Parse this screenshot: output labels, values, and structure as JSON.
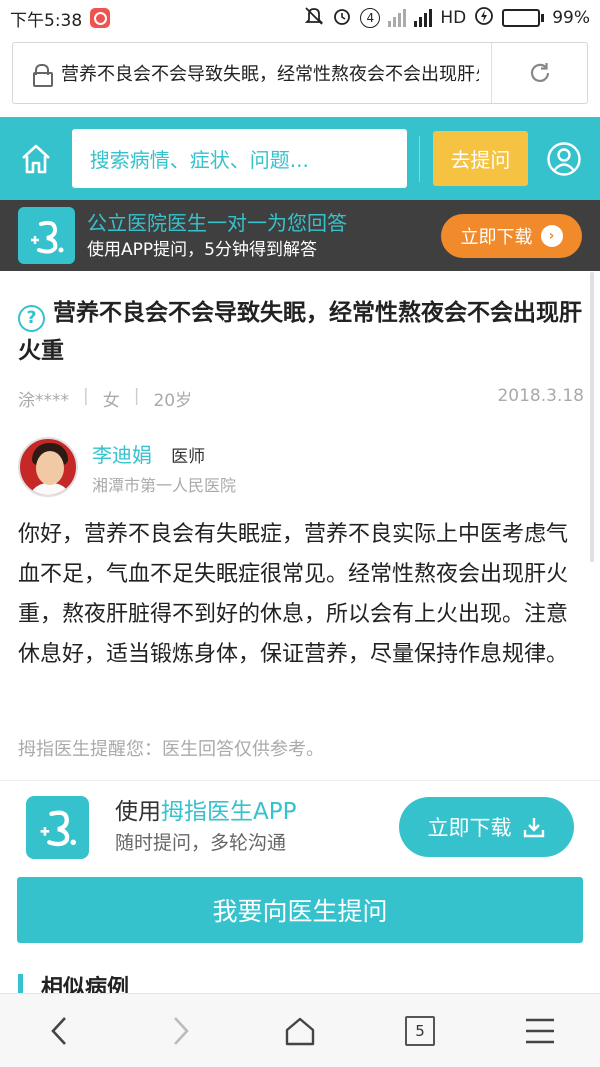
{
  "status_bar": {
    "time": "下午5:38",
    "network": "HD",
    "battery": "99%",
    "sim_badge": "4"
  },
  "browser": {
    "url_title": "营养不良会不会导致失眠，经常性熬夜会不会出现肝火重",
    "open_tabs": "5"
  },
  "header": {
    "search_placeholder": "搜索病情、症状、问题...",
    "ask_label": "去提问"
  },
  "app_banner": {
    "title": "公立医院医生一对一为您回答",
    "subtitle": "使用APP提问，5分钟得到解答",
    "download_label": "立即下载"
  },
  "question": {
    "title": "营养不良会不会导致失眠，经常性熬夜会不会出现肝火重",
    "user": "涂****",
    "gender": "女",
    "age": "20岁",
    "date": "2018.3.18"
  },
  "doctor": {
    "name": "李迪娟",
    "title": "医师",
    "hospital": "湘潭市第一人民医院"
  },
  "answer": {
    "text": "你好，营养不良会有失眠症，营养不良实际上中医考虑气血不足，气血不足失眠症很常见。经常性熬夜会出现肝火重，熬夜肝脏得不到好的休息，所以会有上火出现。注意休息好，适当锻炼身体，保证营养，尽量保持作息规律。",
    "reminder": "拇指医生提醒您：医生回答仅供参考。"
  },
  "promo": {
    "title_prefix": "使用",
    "title_highlight": "拇指医生APP",
    "subtitle": "随时提问，多轮沟通",
    "download_label": "立即下载"
  },
  "ask_doctor_label": "我要向医生提问",
  "similar_cases_label": "相似病例",
  "colors": {
    "accent": "#36c2cc",
    "ask_button": "#f5c242",
    "banner_bg": "#3f3f3f",
    "banner_download": "#f08a2b"
  }
}
